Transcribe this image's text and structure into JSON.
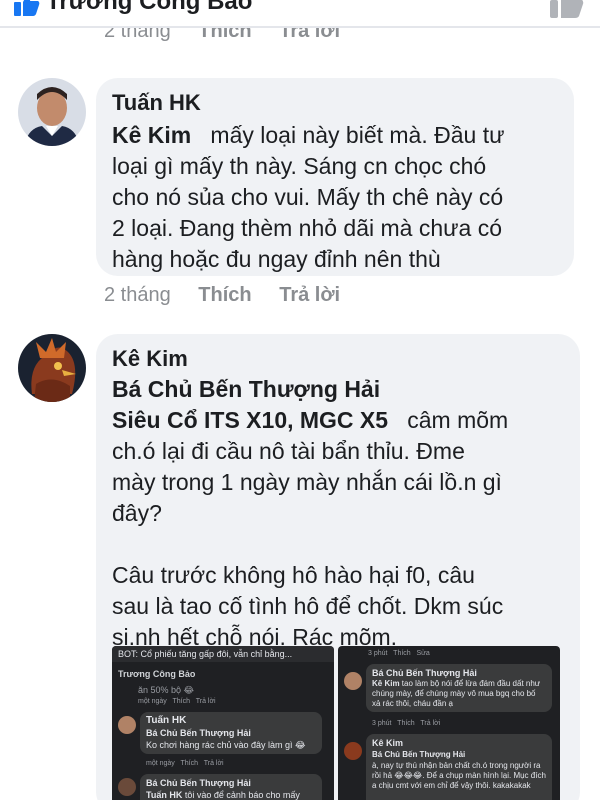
{
  "header": {
    "name": "Trương Công Bảo"
  },
  "prev_comment_meta": {
    "time": "2 tháng",
    "like": "Thích",
    "reply": "Trả lời"
  },
  "comments": [
    {
      "author": "Tuấn HK",
      "mention": "Kê Kim",
      "text_lines": [
        "mấy loại này biết mà. Đầu tư",
        "loại gì mấy th này. Sáng cn chọc chó",
        "cho nó sủa cho vui. Mấy th chê này có",
        "2 loại. Đang thèm nhỏ dãi mà chưa có",
        "hàng hoặc đu ngay đỉnh nên thù"
      ],
      "meta": {
        "time": "2 tháng",
        "like": "Thích",
        "reply": "Trả lời"
      }
    },
    {
      "author": "Kê Kim",
      "mention_lines": [
        "Bá Chủ Bến Thượng Hải",
        "Siêu Cổ ITS X10, MGC X5"
      ],
      "text_lines": [
        "câm mõm",
        "ch.ó lại đi cầu nô tài bẩn thỉu. Đme",
        "mày trong 1 ngày mày nhắn cái lồ.n gì",
        "đây?",
        "",
        "Câu trước không hô hào hại f0, câu",
        "sau là tao cố tình hô để chốt. Dkm súc",
        "si.nh hết chỗ nói. Rác mõm."
      ]
    }
  ],
  "embedded_left": {
    "topbar": "BOT: Cổ phiếu tăng gấp đôi, vẫn chỉ bằng...",
    "page_name": "Trương Công Bảo",
    "cut_text": "ăn 50% bộ 😂",
    "meta1": "một ngày   Thích   Trả lời",
    "c1_author": "Tuấn HK",
    "c1_mention": "Bá Chủ Bến Thượng Hải",
    "c1_text": "Ko chơi hàng rác chủ vào đây làm gì 😂",
    "meta2": "một ngày   Thích   Trả lời",
    "c2_mention": "Bá Chủ Bến Thượng Hải",
    "c2_text_prefix": "Tuấn HK",
    "c2_text": "tôi vào để cảnh báo cho mấy con gà"
  },
  "embedded_right": {
    "meta0": "3 phút   Thích   Sửa",
    "r1_mention": "Bá Chủ Bến Thượng Hải",
    "r1_tag": "Kê Kim",
    "r1_text": "tao làm bộ nói để lừa đám đầu dất như chúng mày, để chúng mày vô mua bgq cho bố xả rác thôi, cháu đần ạ",
    "meta1": "3 phút   Thích   Trả lời",
    "r2_author": "Kê Kim",
    "r2_mention": "Bá Chủ Bến Thượng Hải",
    "r2_text": "à, nay tự thú nhận bản chất ch.ó trong người ra rồi hả 😂😂😂. Để a chụp màn hình lại. Mục đích a chịu cmt với em chỉ để vậy thôi. kakakakak"
  },
  "colors": {
    "bubble": "#f0f2f5",
    "meta": "#8a8d91",
    "text": "#1c1e21",
    "link": "#1877f2"
  }
}
